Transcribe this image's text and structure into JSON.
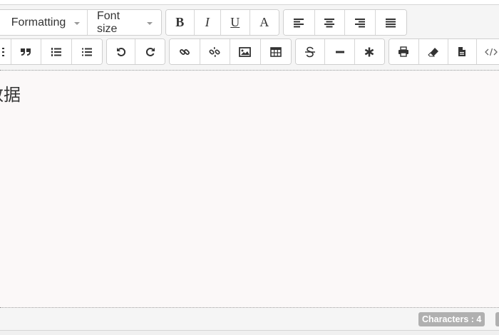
{
  "toolbar": {
    "formatting_label": "Formatting",
    "fontsize_label": "Font size",
    "bold_label": "B",
    "italic_label": "I",
    "underline_label": "U",
    "fontcolor_label": "A"
  },
  "editor": {
    "content": "数据"
  },
  "status": {
    "characters_label": "Characters : 4"
  },
  "colors": {
    "editor_bg": "#fbf8f8",
    "badge_bg": "#b0b0b0"
  }
}
